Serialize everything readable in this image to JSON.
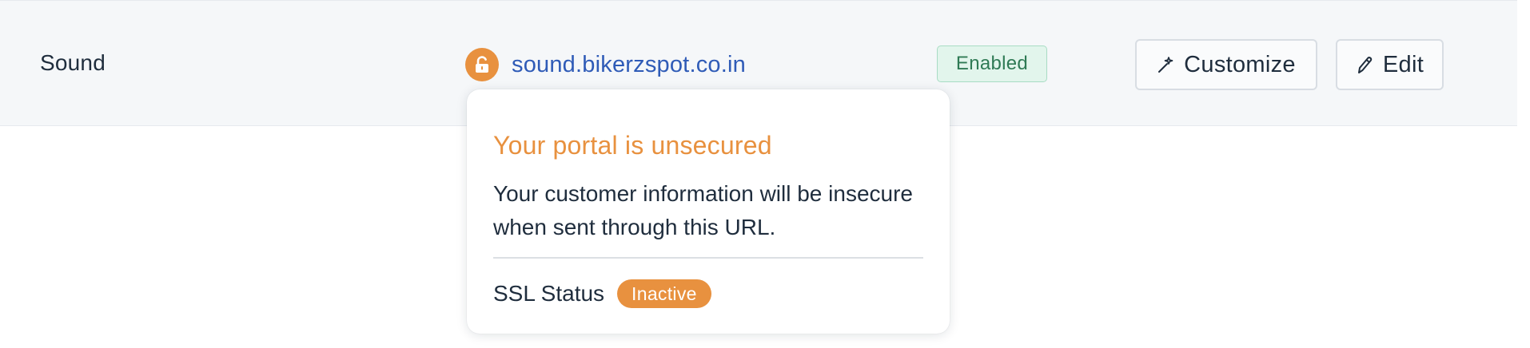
{
  "row": {
    "portal_name": "Sound",
    "domain": "sound.bikerzspot.co.in",
    "status": "Enabled",
    "customize_label": "Customize",
    "edit_label": "Edit"
  },
  "popover": {
    "title": "Your portal is unsecured",
    "body": "Your customer information will be insecure when sent through this URL.",
    "ssl_label": "SSL Status",
    "ssl_status": "Inactive"
  },
  "icons": {
    "lock": "unlocked-lock-icon",
    "customize": "wand-icon",
    "edit": "pencil-icon"
  },
  "colors": {
    "warning": "#e8913f",
    "link": "#2f5bb7",
    "enabled_bg": "#e2f5ec",
    "enabled_text": "#2f7a55"
  }
}
